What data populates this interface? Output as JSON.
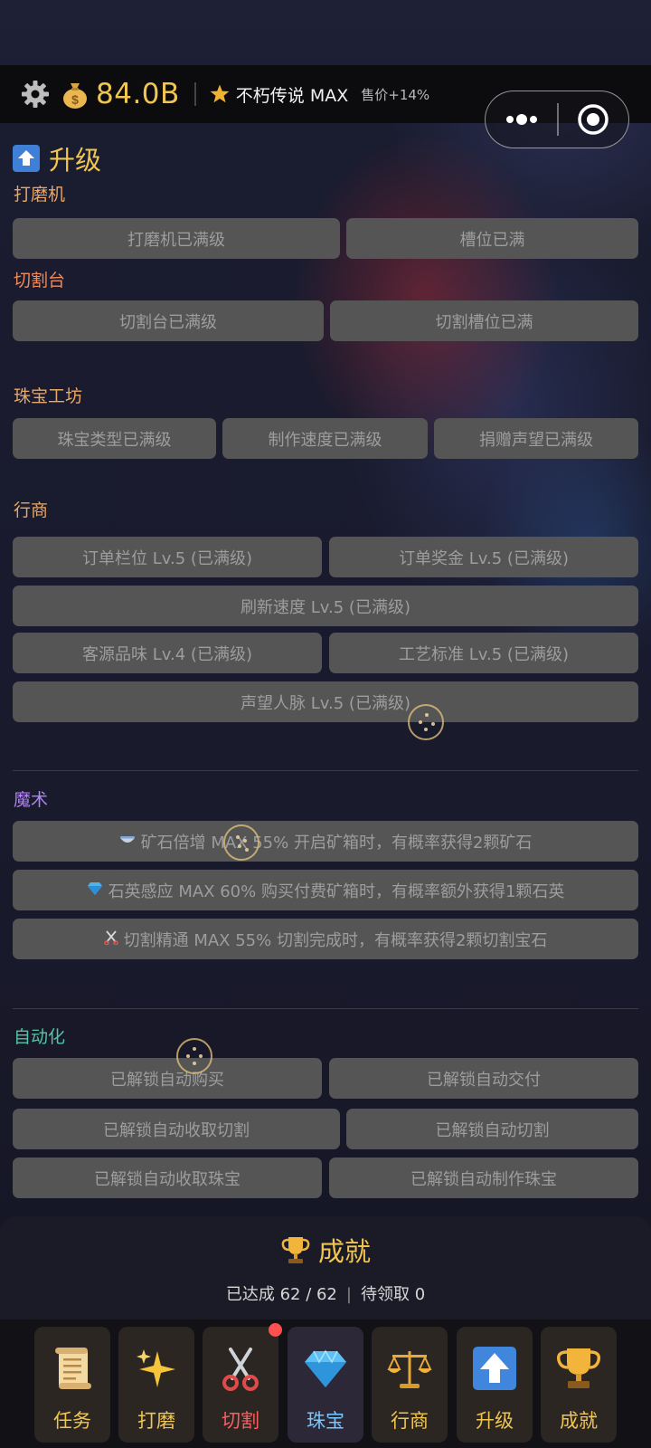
{
  "header": {
    "coins": "84.0B",
    "rank": "不朽传说 MAX",
    "sale": "售价+14%"
  },
  "upgrade": {
    "title": "升级",
    "grinder": {
      "label": "打磨机",
      "buttons": [
        "打磨机已满级",
        "槽位已满"
      ]
    },
    "cutter": {
      "label": "切割台",
      "buttons": [
        "切割台已满级",
        "切割槽位已满"
      ]
    },
    "workshop": {
      "label": "珠宝工坊",
      "buttons": [
        "珠宝类型已满级",
        "制作速度已满级",
        "捐赠声望已满级"
      ]
    },
    "merchant": {
      "label": "行商",
      "buttons": [
        "订单栏位 Lv.5 (已满级)",
        "订单奖金 Lv.5 (已满级)",
        "刷新速度 Lv.5 (已满级)",
        "客源品味 Lv.4 (已满级)",
        "工艺标准 Lv.5 (已满级)",
        "声望人脉 Lv.5 (已满级)"
      ]
    },
    "magic": {
      "label": "魔术",
      "items": [
        {
          "icon": "bowl-icon",
          "text": "矿石倍增 MAX 55% 开启矿箱时，有概率获得2颗矿石"
        },
        {
          "icon": "gem-icon",
          "text": "石英感应 MAX 60% 购买付费矿箱时，有概率额外获得1颗石英"
        },
        {
          "icon": "scissors-icon",
          "text": "切割精通 MAX 55% 切割完成时，有概率获得2颗切割宝石"
        }
      ]
    },
    "automation": {
      "label": "自动化",
      "buttons": [
        "已解锁自动购买",
        "已解锁自动交付",
        "已解锁自动收取切割",
        "已解锁自动切割",
        "已解锁自动收取珠宝",
        "已解锁自动制作珠宝"
      ]
    }
  },
  "achievements": {
    "title": "成就",
    "progress": "已达成 62 / 62",
    "sep": "|",
    "pending": "待领取 0"
  },
  "nav": [
    "任务",
    "打磨",
    "切割",
    "珠宝",
    "行商",
    "升级",
    "成就"
  ],
  "colors": {
    "gold": "#f0c552",
    "button_bg": "#555555",
    "button_text": "#9d9d9d",
    "grinder_label": "#e8a766",
    "cutter_label": "#f08a5a",
    "workshop_label": "#e8a766",
    "merchant_label": "#e8a766",
    "magic_label": "#b084f2",
    "automation_label": "#56c4a4"
  }
}
